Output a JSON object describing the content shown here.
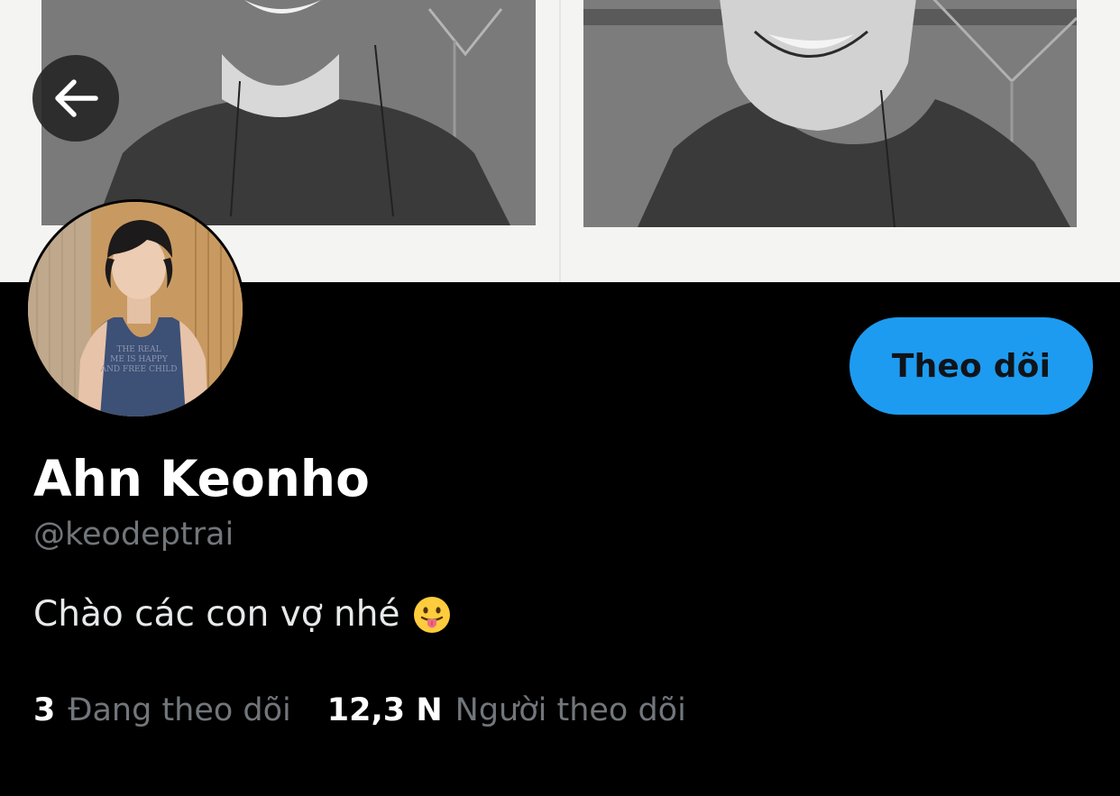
{
  "profile": {
    "display_name": "Ahn Keonho",
    "handle": "@keodeptrai",
    "bio": "Chào các con vợ nhé",
    "bio_emoji": "face-with-tongue-icon"
  },
  "actions": {
    "follow_label": "Theo dõi",
    "back_icon": "arrow-left-icon"
  },
  "stats": {
    "following_count": "3",
    "following_label": "Đang theo dõi",
    "followers_count": "12,3 N",
    "followers_label": "Người theo dõi"
  },
  "colors": {
    "background": "#000000",
    "accent": "#1d9bf0",
    "primary_text": "#ffffff",
    "secondary_text": "#71767b"
  }
}
